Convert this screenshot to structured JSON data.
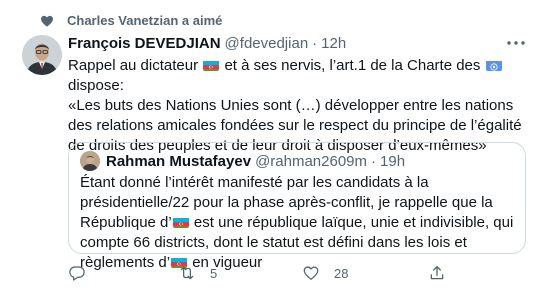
{
  "social_context": {
    "text": "Charles Vanetzian a aimé",
    "icon": "heart-icon"
  },
  "tweet": {
    "author_name": "François DEVEDJIAN",
    "author_handle": "@fdevedjian",
    "separator": "·",
    "time": "12h",
    "text_parts": {
      "p1": "Rappel au dictateur",
      "p2": "et à ses nervis, l’art.1 de la Charte des",
      "p3": "dispose:",
      "p4": "«Les buts des Nations Unies sont (…) développer entre les nations des relations amicales fondées sur le respect du principe de l’égalité de droits des peuples et de leur droit à disposer d’eux-mêmes»"
    },
    "flags": {
      "azerbaijan": "azerbaijan-flag",
      "un": "united-nations-flag"
    }
  },
  "quoted_tweet": {
    "author_name": "Rahman Mustafayev",
    "author_handle": "@rahman2609m",
    "separator": "·",
    "time": "19h",
    "text_parts": {
      "p1": "Étant donné l’intérêt manifesté par les candidats à la présidentielle/22 pour la phase après-conflit, je rappelle que la République d’",
      "p2": "est une république laïque, unie et indivisible, qui compte 66 districts, dont le statut est défini dans les lois et règlements d’",
      "p3": "en vigueur"
    }
  },
  "actions": {
    "reply": {
      "icon": "reply-icon",
      "count": ""
    },
    "retweet": {
      "icon": "retweet-icon",
      "count": "5"
    },
    "like": {
      "icon": "like-icon",
      "count": "28"
    },
    "share": {
      "icon": "share-icon"
    }
  },
  "colors": {
    "text_primary": "#0f1419",
    "text_secondary": "#536471",
    "border": "#cfd9de",
    "flag_blue": "#00b5e2",
    "flag_red": "#ef3340",
    "flag_green": "#509e2f",
    "un_blue": "#5b92e5"
  }
}
